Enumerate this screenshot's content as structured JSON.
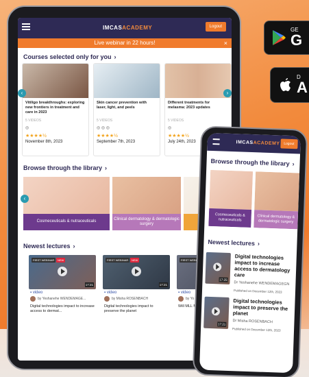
{
  "brand": {
    "logo_main": "IMCAS",
    "logo_accent": "ACADEMY",
    "accent_color": "#f07b2c",
    "nav_color": "#2e2a55"
  },
  "header": {
    "login_label": "Logout"
  },
  "banner": {
    "text": "Live webinar in 22 hours!",
    "close_icon": "×"
  },
  "courses": {
    "title": "Courses selected only for you",
    "items": [
      {
        "title": "Vitiligo breakthroughs: exploring new frontiers in treatment and care in 2023",
        "videos": "5 VIDEOS",
        "stars": "★★★★½",
        "date": "November 8th, 2023"
      },
      {
        "title": "Skin cancer prevention with laser, light, and peels",
        "videos": "5 VIDEOS",
        "stars": "★★★★½",
        "date": "September 7th, 2023"
      },
      {
        "title": "Different treatments for melasma: 2023 updates",
        "videos": "5 VIDEOS",
        "stars": "★★★★½",
        "date": "July 24th, 2023"
      }
    ]
  },
  "library": {
    "title": "Browse through the library",
    "items": [
      {
        "label": "Cosmeceuticals & nutraceuticals"
      },
      {
        "label": "Clinical dermatology & dermatologic surgery"
      },
      {
        "label": "Injec"
      }
    ]
  },
  "lectures": {
    "title": "Newest lectures",
    "items": [
      {
        "tag1": "FIRST WEBINAR",
        "tag2": "NEW",
        "duration": "17:21",
        "video_label": "video",
        "author": "by Yeshanehe WENDEMAGE...",
        "title": "Digital technologies impact to increase access to dermat..."
      },
      {
        "tag1": "FIRST WEBINAR",
        "tag2": "NEW",
        "duration": "17:21",
        "video_label": "video",
        "author": "by Misha ROSENBACH",
        "title": "Digital technologies impact to preserve the planet"
      },
      {
        "tag1": "FIRST WEBINAR",
        "tag2": "",
        "duration": "",
        "video_label": "video",
        "author": "by Yo",
        "title": "Will MLL Ma dermatology"
      }
    ]
  },
  "phone": {
    "library_title": "Browse through the library",
    "library_items": [
      {
        "label": "Cosmeceuticals & nutraceuticals"
      },
      {
        "label": "Clinical dermatology & dermatologic surgery"
      }
    ],
    "lectures_title": "Newest lectures",
    "lectures": [
      {
        "title": "Digital technologies impact to increase access to dermatology care",
        "duration": "17:25",
        "author": "Dr Yeshanehe WENDEMAGEGN",
        "date": "Published on December 12th, 2023"
      },
      {
        "title": "Digital technologies impact to preserve the planet",
        "duration": "17:21",
        "author": "Dr Misha ROSENBACH",
        "date": "Published on December 12th, 2023"
      }
    ]
  },
  "stores": {
    "google_small": "GE",
    "google_big": "G",
    "apple_small": "D",
    "apple_big": "A"
  }
}
